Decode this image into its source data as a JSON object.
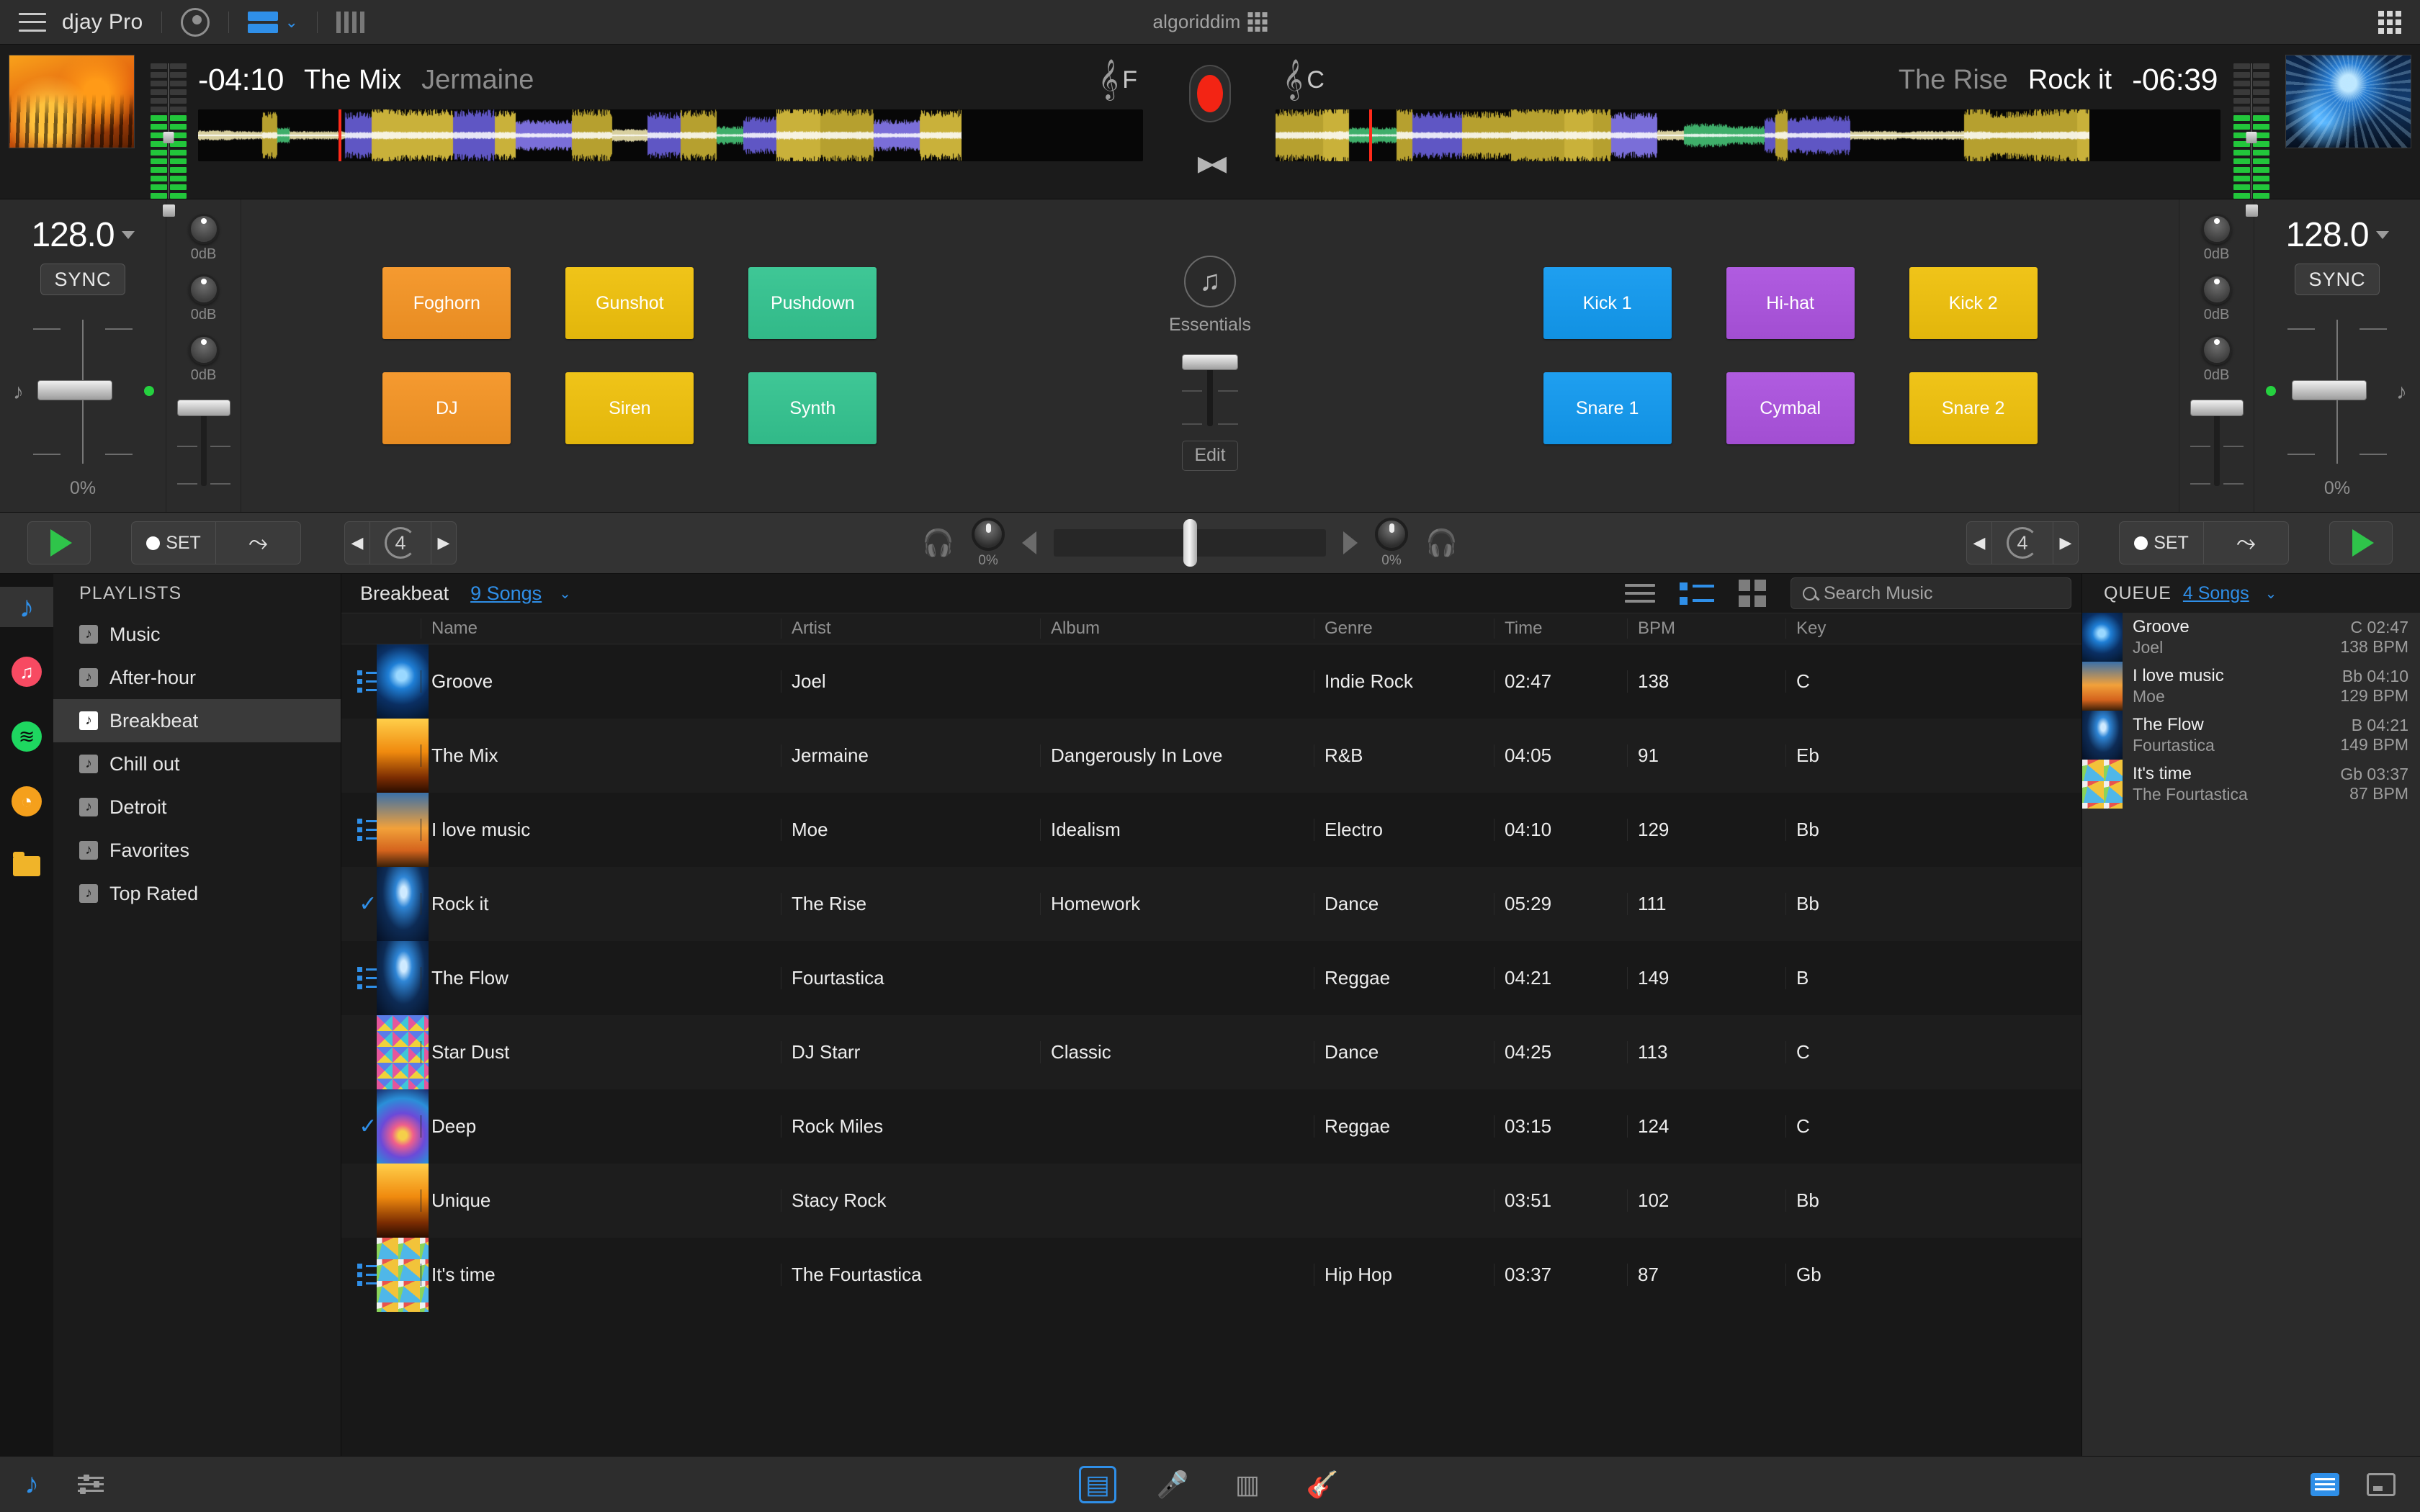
{
  "titlebar": {
    "app_name": "djay Pro",
    "brand": "algoriddim",
    "icons": [
      "hamburger-icon",
      "vinyl-icon",
      "layout-icon",
      "chevron-down-icon",
      "bars-icon",
      "grid-icon"
    ]
  },
  "deck_left": {
    "time_remaining": "-04:10",
    "title": "The Mix",
    "artist": "Jermaine",
    "key": "F",
    "bpm": "128.0",
    "sync_label": "SYNC",
    "pitch_percent": "0%",
    "gain_labels": [
      "0dB",
      "0dB",
      "0dB"
    ]
  },
  "deck_right": {
    "time_remaining": "-06:39",
    "title": "Rock it",
    "artist": "The Rise",
    "key": "C",
    "bpm": "128.0",
    "sync_label": "SYNC",
    "pitch_percent": "0%",
    "gain_labels": [
      "0dB",
      "0dB",
      "0dB"
    ]
  },
  "pads_left": [
    {
      "label": "Foghorn",
      "color": "#f59a30"
    },
    {
      "label": "Gunshot",
      "color": "#f0c419"
    },
    {
      "label": "Pushdown",
      "color": "#3fc796"
    },
    {
      "label": "DJ",
      "color": "#f59a30"
    },
    {
      "label": "Siren",
      "color": "#f0c419"
    },
    {
      "label": "Synth",
      "color": "#3fc796"
    }
  ],
  "pads_right": [
    {
      "label": "Kick 1",
      "color": "#1f9ff0"
    },
    {
      "label": "Hi-hat",
      "color": "#a martes"
    },
    {
      "label": "Kick 2",
      "color": "#f0c419"
    },
    {
      "label": "Snare 1",
      "color": "#1f9ff0"
    },
    {
      "label": "Cymbal",
      "color": "#b05ce0"
    },
    {
      "label": "Snare 2",
      "color": "#f0c419"
    }
  ],
  "essentials": {
    "label": "Essentials",
    "edit_label": "Edit"
  },
  "transport": {
    "set_label": "SET",
    "loop_beats": "4",
    "cue_percent": "0%"
  },
  "sources": [
    {
      "name": "music-library",
      "icon": "music-note-icon",
      "active": true
    },
    {
      "name": "apple-music",
      "icon": "apple-music-icon",
      "active": false
    },
    {
      "name": "spotify",
      "icon": "spotify-icon",
      "active": false
    },
    {
      "name": "history",
      "icon": "clock-icon",
      "active": false
    },
    {
      "name": "folders",
      "icon": "folder-icon",
      "active": false
    }
  ],
  "playlists": {
    "header": "PLAYLISTS",
    "items": [
      {
        "label": "Music",
        "active": false
      },
      {
        "label": "After-hour",
        "active": false
      },
      {
        "label": "Breakbeat",
        "active": true
      },
      {
        "label": "Chill out",
        "active": false
      },
      {
        "label": "Detroit",
        "active": false
      },
      {
        "label": "Favorites",
        "active": false
      },
      {
        "label": "Top Rated",
        "active": false
      }
    ]
  },
  "library": {
    "playlist_name": "Breakbeat",
    "song_count": "9 Songs",
    "search_placeholder": "Search Music",
    "search_value": "",
    "view_modes": [
      "list-view-icon",
      "detail-view-icon",
      "grid-view-icon"
    ],
    "columns": [
      "Name",
      "Artist",
      "Album",
      "Genre",
      "Time",
      "BPM",
      "Key"
    ],
    "rows": [
      {
        "mark": "queued",
        "name": "Groove",
        "artist": "Joel",
        "album": "",
        "genre": "Indie Rock",
        "time": "02:47",
        "bpm": "138",
        "key": "C",
        "art": "blue-dj"
      },
      {
        "mark": "",
        "name": "The Mix",
        "artist": "Jermaine",
        "album": "Dangerously In Love",
        "genre": "R&B",
        "time": "04:05",
        "bpm": "91",
        "key": "Eb",
        "art": "crowd"
      },
      {
        "mark": "queued",
        "name": "I love music",
        "artist": "Moe",
        "album": "Idealism",
        "genre": "Electro",
        "time": "04:10",
        "bpm": "129",
        "key": "Bb",
        "art": "palms"
      },
      {
        "mark": "played",
        "name": "Rock it",
        "artist": "The Rise",
        "album": "Homework",
        "genre": "Dance",
        "time": "05:29",
        "bpm": "111",
        "key": "Bb",
        "art": "dancer"
      },
      {
        "mark": "queued",
        "name": "The Flow",
        "artist": "Fourtastica",
        "album": "",
        "genre": "Reggae",
        "time": "04:21",
        "bpm": "149",
        "key": "B",
        "art": "dancer"
      },
      {
        "mark": "",
        "name": "Star Dust",
        "artist": "DJ Starr",
        "album": "Classic",
        "genre": "Dance",
        "time": "04:25",
        "bpm": "113",
        "key": "C",
        "art": "diamonds"
      },
      {
        "mark": "played",
        "name": "Deep",
        "artist": "Rock Miles",
        "album": "",
        "genre": "Reggae",
        "time": "03:15",
        "bpm": "124",
        "key": "C",
        "art": "triangle"
      },
      {
        "mark": "",
        "name": "Unique",
        "artist": "Stacy Rock",
        "album": "",
        "genre": "",
        "time": "03:51",
        "bpm": "102",
        "key": "Bb",
        "art": "crowd"
      },
      {
        "mark": "queued",
        "name": "It's time",
        "artist": "The Fourtastica",
        "album": "",
        "genre": "Hip Hop",
        "time": "03:37",
        "bpm": "87",
        "key": "Gb",
        "art": "dots"
      }
    ]
  },
  "queue": {
    "title": "QUEUE",
    "count": "4 Songs",
    "items": [
      {
        "name": "Groove",
        "artist": "Joel",
        "key_time": "C 02:47",
        "bpm": "138 BPM",
        "art": "blue-dj"
      },
      {
        "name": "I love music",
        "artist": "Moe",
        "key_time": "Bb 04:10",
        "bpm": "129 BPM",
        "art": "palms"
      },
      {
        "name": "The Flow",
        "artist": "Fourtastica",
        "key_time": "B 04:21",
        "bpm": "149 BPM",
        "art": "dancer"
      },
      {
        "name": "It's time",
        "artist": "The Fourtastica",
        "key_time": "Gb 03:37",
        "bpm": "87 BPM",
        "art": "dots"
      }
    ]
  },
  "bottombar": {
    "left_icons": [
      "music-note-icon",
      "mixer-icon"
    ],
    "center_icons": [
      "library-icon",
      "microphone-icon",
      "sampler-icon",
      "instruments-icon"
    ],
    "right_icons": [
      "library-toggle-icon",
      "fullscreen-icon"
    ]
  },
  "colors": {
    "accent": "#2f8fe8",
    "play_green": "#2fc44a",
    "record_red": "#f32414"
  }
}
